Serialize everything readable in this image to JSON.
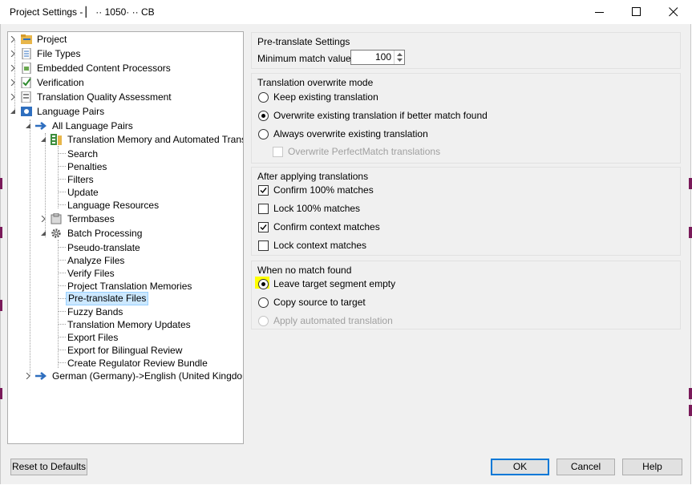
{
  "window": {
    "title": "Project Settings - ▏  ·· 1050·  ··  CB",
    "minimize_icon": "minimize-icon",
    "maximize_icon": "maximize-icon",
    "close_icon": "close-icon"
  },
  "tree": {
    "project": "Project",
    "file_types": "File Types",
    "embedded": "Embedded Content Processors",
    "verification": "Verification",
    "tqa": "Translation Quality Assessment",
    "language_pairs": "Language Pairs",
    "all_language_pairs": "All Language Pairs",
    "tm_automated": "Translation Memory and Automated Transl",
    "search": "Search",
    "penalties": "Penalties",
    "filters": "Filters",
    "update": "Update",
    "language_resources": "Language Resources",
    "termbases": "Termbases",
    "batch_processing": "Batch Processing",
    "pseudo_translate": "Pseudo-translate",
    "analyze_files": "Analyze Files",
    "verify_files": "Verify Files",
    "project_tms": "Project Translation Memories",
    "pretranslate_files": "Pre-translate Files",
    "fuzzy_bands": "Fuzzy Bands",
    "tm_updates": "Translation Memory Updates",
    "export_files": "Export Files",
    "export_bilingual": "Export for Bilingual Review",
    "regulator_bundle": "Create Regulator Review Bundle",
    "german_english": "German (Germany)->English (United Kingdom)"
  },
  "pretranslate_settings": {
    "title": "Pre-translate Settings",
    "min_match_label": "Minimum match value:",
    "min_match_value": "100"
  },
  "overwrite_mode": {
    "title": "Translation overwrite mode",
    "keep": "Keep existing translation",
    "overwrite_better": "Overwrite existing translation if better match found",
    "always_overwrite": "Always overwrite existing translation",
    "overwrite_perfect": "Overwrite PerfectMatch translations",
    "selected": "overwrite_better"
  },
  "after_applying": {
    "title": "After applying translations",
    "confirm100": "Confirm 100% matches",
    "lock100": "Lock 100% matches",
    "confirm_context": "Confirm context matches",
    "lock_context": "Lock context matches",
    "checked": [
      "confirm100",
      "confirm_context"
    ]
  },
  "no_match": {
    "title": "When no match found",
    "leave_empty": "Leave target segment empty",
    "copy_source": "Copy source to target",
    "apply_automated": "Apply automated translation",
    "selected": "leave_empty",
    "highlight_color": "#ffff00"
  },
  "buttons": {
    "reset": "Reset to Defaults",
    "ok": "OK",
    "cancel": "Cancel",
    "help": "Help"
  },
  "colors": {
    "selection": "#cce8ff",
    "arrow_blue": "#2f6fbf",
    "dialog_bg": "#f0f0f0"
  }
}
